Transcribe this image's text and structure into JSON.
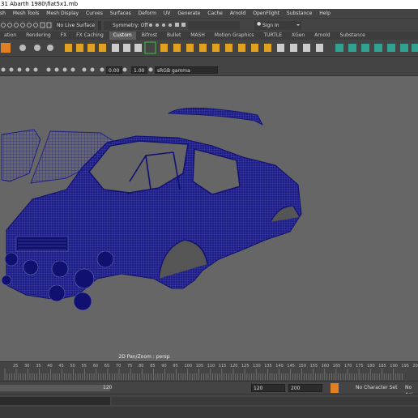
{
  "title": "31 Abarth 1980\\fiat5x1.mb",
  "menus": [
    "sh",
    "Mesh Tools",
    "Mesh Display",
    "Curves",
    "Surfaces",
    "Deform",
    "UV",
    "Generate",
    "Cache",
    "Arnold",
    "OpenFlight",
    "Substance",
    "Help"
  ],
  "status": {
    "live_surface": "No Live Surface",
    "symmetry": "Symmetry: Off",
    "sign_in": "Sign In"
  },
  "shelf_tabs": [
    "ation",
    "Rendering",
    "FX",
    "FX Caching",
    "Custom",
    "Bifrost",
    "Bullet",
    "MASH",
    "Motion Graphics",
    "TURTLE",
    "XGen",
    "Arnold",
    "Substance"
  ],
  "shelf_active": "Custom",
  "panel": {
    "field1": "0.00",
    "field2": "1.00",
    "colorspace": "sRGB gamma"
  },
  "viewport": {
    "camera_label": "2D Pan/Zoom : persp",
    "wire_color": "#1a1a8c"
  },
  "timeline": {
    "ticks": [
      "25",
      "30",
      "35",
      "40",
      "45",
      "50",
      "55",
      "60",
      "65",
      "70",
      "75",
      "80",
      "85",
      "90",
      "95",
      "100",
      "105",
      "110",
      "115",
      "120",
      "125",
      "130",
      "135",
      "140",
      "145",
      "150",
      "155",
      "160",
      "165",
      "170",
      "175",
      "180",
      "185",
      "190",
      "195",
      "200"
    ]
  },
  "range": {
    "inner_end": "120",
    "current_end": "120",
    "range_end": "200",
    "character_set": "No Character Set",
    "anim_layer": "No Ani"
  }
}
